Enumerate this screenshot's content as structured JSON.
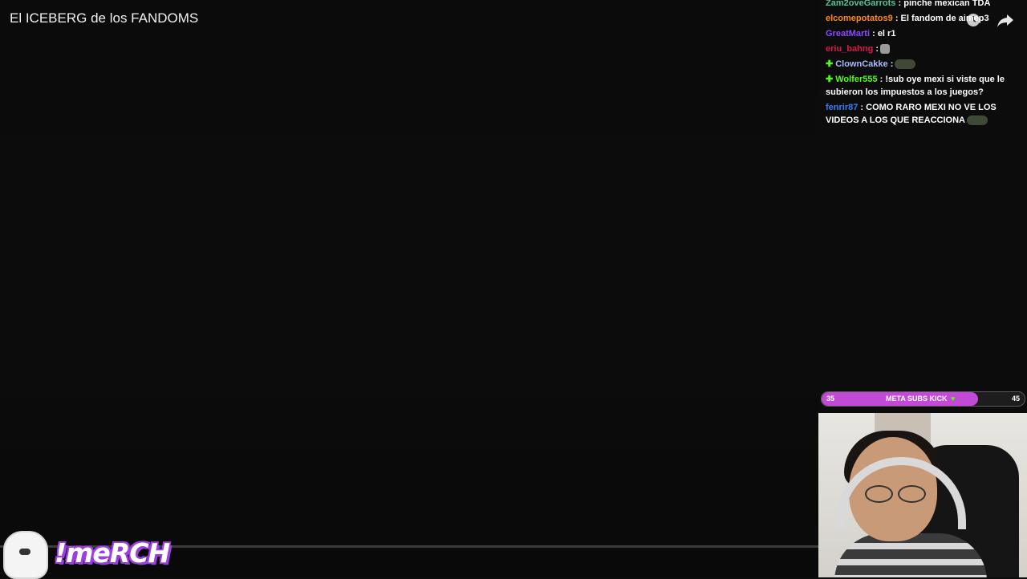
{
  "video": {
    "title": "El ICEBERG de los FANDOMS"
  },
  "icons": {
    "clock": "clock-icon",
    "share": "share-icon"
  },
  "chat": {
    "messages": [
      {
        "user": "Zam2oveGarrots",
        "user_color": "#53c4a0",
        "text": ": pinche mexican TDA",
        "badge": ""
      },
      {
        "user": "elcomepotatos9",
        "user_color": "#ff8c1a",
        "text": ": El fandom de aimep3",
        "badge": ""
      },
      {
        "user": "GreatMarti",
        "user_color": "#8a4bff",
        "text": ": el r1",
        "badge": ""
      },
      {
        "user": "eriu_bahng",
        "user_color": "#d81a4a",
        "text": ":",
        "badge": "",
        "emote": "small"
      },
      {
        "user": "ClownCakke",
        "user_color": "#a9b9ff",
        "text": ":",
        "badge": "✚",
        "emote": "car"
      },
      {
        "user": "Wolfer555",
        "user_color": "#53fc18",
        "text": ": !sub oye mexi si viste que le subieron los impuestos a los juegos?",
        "badge": "✚"
      },
      {
        "user": "fenrir87",
        "user_color": "#2f7fff",
        "text": ": COMO RARO MEXI NO VE LOS VIDEOS A LOS QUE REACCIONA",
        "badge": "",
        "emote": "car"
      }
    ]
  },
  "meta_goal": {
    "min": "35",
    "label": "META SUBS KICK",
    "max": "45",
    "heart": "♥",
    "progress_fraction": 0.77,
    "fill_color": "#c24ad6"
  },
  "merch": {
    "label": "!meRCH"
  }
}
